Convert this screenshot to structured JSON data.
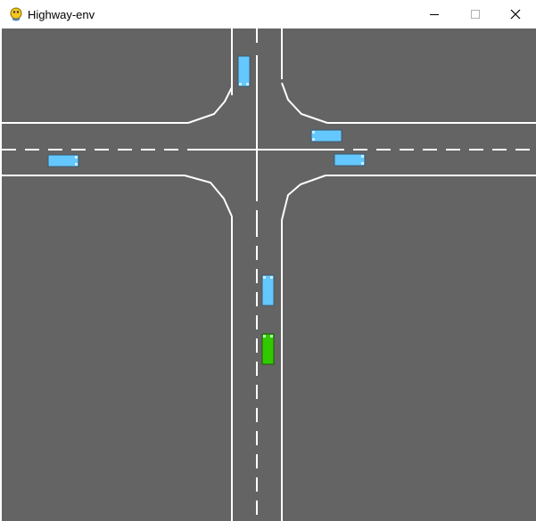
{
  "window": {
    "title": "Highway-env",
    "app_icon": "pygame-snake-icon",
    "controls": {
      "minimize_icon": "minimize-icon",
      "maximize_icon": "maximize-icon",
      "close_icon": "close-icon"
    }
  },
  "scene": {
    "road_color": "#646464",
    "lane_marking_color": "#ffffff",
    "vehicle_colors": {
      "ego": "#32c800",
      "other": "#64c8ff"
    },
    "vehicles": [
      {
        "role": "other",
        "heading": "vertical"
      },
      {
        "role": "other",
        "heading": "horizontal"
      },
      {
        "role": "other",
        "heading": "horizontal"
      },
      {
        "role": "other",
        "heading": "horizontal"
      },
      {
        "role": "other",
        "heading": "vertical"
      },
      {
        "role": "ego",
        "heading": "vertical"
      }
    ]
  }
}
